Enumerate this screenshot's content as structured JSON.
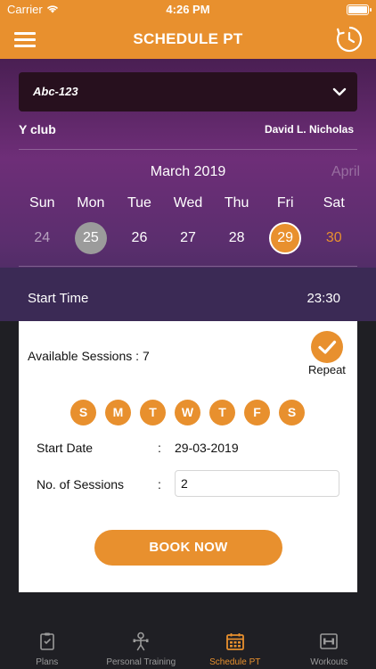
{
  "status_bar": {
    "carrier": "Carrier",
    "time": "4:26 PM"
  },
  "header": {
    "title": "SCHEDULE PT"
  },
  "selector": {
    "value": "Abc-123"
  },
  "info": {
    "club": "Y club",
    "trainer": "David L. Nicholas"
  },
  "calendar": {
    "month": "March 2019",
    "next_month": "April",
    "weekdays": [
      "Sun",
      "Mon",
      "Tue",
      "Wed",
      "Thu",
      "Fri",
      "Sat"
    ],
    "dates": [
      "24",
      "25",
      "26",
      "27",
      "28",
      "29",
      "30"
    ]
  },
  "start_time": {
    "label": "Start Time",
    "value": "23:30"
  },
  "card": {
    "available_label": "Available Sessions :",
    "available_count": "7",
    "repeat_label": "Repeat",
    "repeat_days": [
      "S",
      "M",
      "T",
      "W",
      "T",
      "F",
      "S"
    ],
    "start_date_label": "Start Date",
    "colon": ":",
    "start_date_value": "29-03-2019",
    "sessions_label": "No. of Sessions",
    "sessions_value": "2",
    "book_label": "BOOK NOW"
  },
  "tabs": [
    {
      "label": "Plans",
      "icon": "clipboard-icon"
    },
    {
      "label": "Personal Training",
      "icon": "trainer-icon"
    },
    {
      "label": "Schedule PT",
      "icon": "calendar-icon"
    },
    {
      "label": "Workouts",
      "icon": "dumbbell-icon"
    }
  ],
  "colors": {
    "accent": "#e8902e",
    "hero_top": "#4a1f53",
    "hero_mid": "#6e2e78",
    "dark": "#1f1f24"
  }
}
